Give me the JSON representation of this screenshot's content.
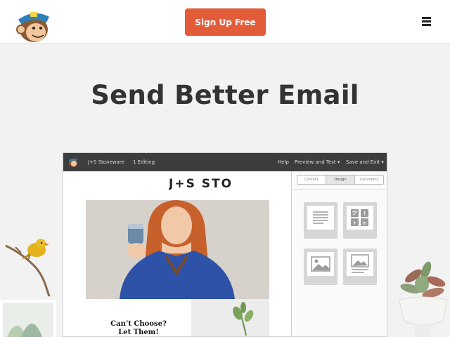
{
  "nav": {
    "logo_icon": "freddie-monkey-logo",
    "cta_label": "Sign Up Free",
    "menu_icon": "hamburger-menu-icon"
  },
  "hero": {
    "headline": "Send Better Email"
  },
  "editor": {
    "toolbar": {
      "campaign_name": "J+S Stoneware",
      "step": "1 Editing",
      "help": "Help",
      "preview": "Preview and Test ▾",
      "save": "Save and Exit ▾"
    },
    "email": {
      "brand": "J+S STONEWARE",
      "promo_line1": "Can’t Choose?",
      "promo_line2": "Let Them!"
    },
    "panel_tabs": [
      {
        "label": "Content",
        "active": false
      },
      {
        "label": "Design",
        "active": true
      },
      {
        "label": "Comments",
        "active": false
      }
    ],
    "content_blocks": [
      {
        "icon": "text-block-icon"
      },
      {
        "icon": "social-follow-icon"
      },
      {
        "icon": "image-block-icon"
      },
      {
        "icon": "image-card-icon"
      }
    ]
  },
  "colors": {
    "accent": "#e35c3a",
    "background": "#f2f2f2",
    "toolbar": "#3d3d3d"
  }
}
